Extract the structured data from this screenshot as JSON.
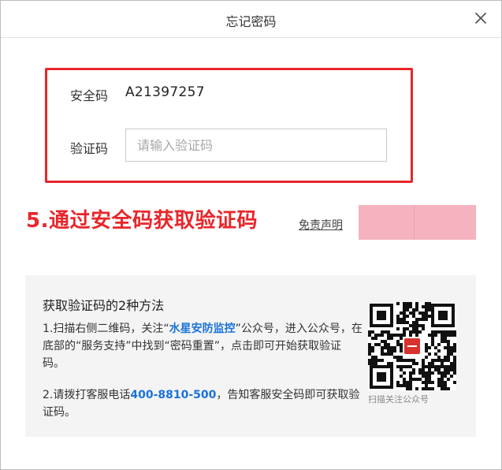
{
  "dialog": {
    "title": "忘记密码",
    "close_icon": "close-icon"
  },
  "form": {
    "security_code_label": "安全码",
    "security_code_value": "A21397257",
    "verify_code_label": "验证码",
    "verify_code_placeholder": "请输入验证码",
    "verify_code_value": ""
  },
  "annotation": {
    "text": "5.通过安全码获取验证码",
    "color": "#e8262b"
  },
  "disclaimer": {
    "label": "免责声明"
  },
  "redaction_color": "#f5b3c0",
  "info": {
    "title": "获取验证码的2种方法",
    "method1": {
      "part1": "1.扫描右侧二维码，关注“",
      "highlight": "水星安防监控",
      "part2": "”公众号，进入公众号，在底部的“服务支持”中找到“密码重置”，点击即可开始获取验证码。"
    },
    "method2": {
      "part1": "2.请拨打客服电话",
      "highlight": "400-8810-500",
      "part2": "，告知客服安全码即可获取验证码。"
    },
    "qr_icon": "qr-code-icon",
    "qr_caption": "扫描关注公众号",
    "highlight_color": "#1a73d9"
  }
}
